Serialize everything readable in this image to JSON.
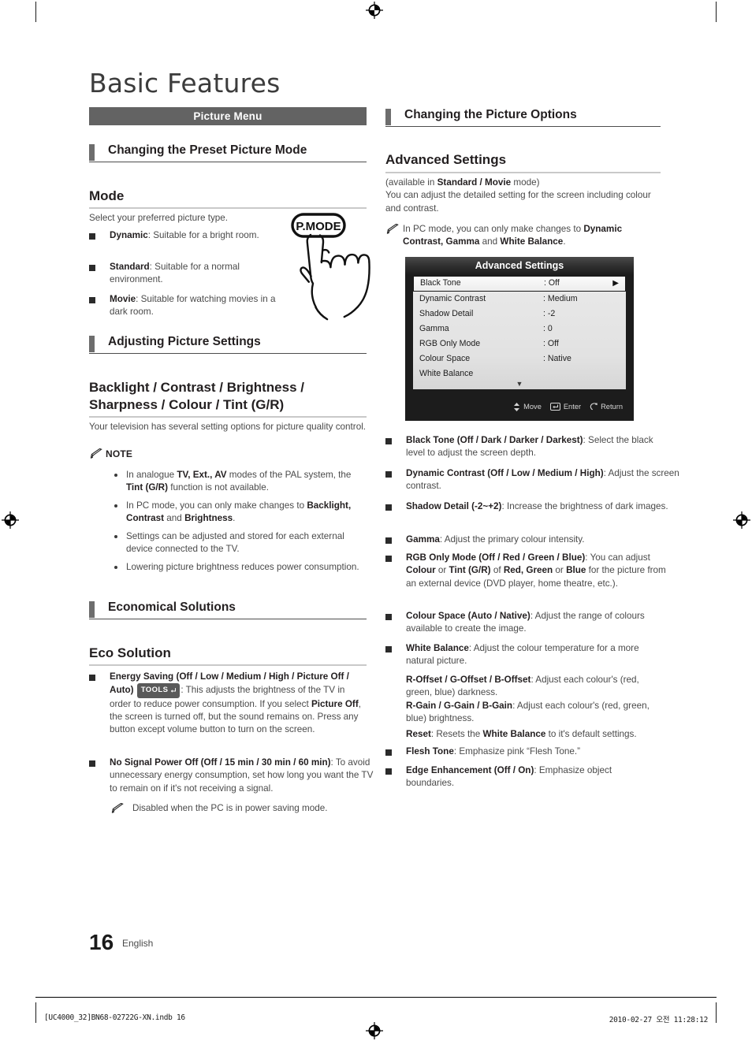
{
  "page": {
    "doc_title": "Basic Features",
    "chapter_bar": "Picture Menu",
    "page_number": "16",
    "language": "English",
    "footer_left": "[UC4000_32]BN68-02722G-XN.indb   16",
    "footer_right": "2010-02-27   오전 11:28:12"
  },
  "left_column": {
    "section1": {
      "title": "Changing the Preset Picture Mode"
    },
    "mode": {
      "heading": "Mode",
      "intro": "Select your preferred picture type.",
      "items": [
        {
          "term": "Dynamic",
          "desc": ": Suitable for a bright room."
        },
        {
          "term": "Standard",
          "desc": ": Suitable for a normal environment."
        },
        {
          "term": "Movie",
          "desc": ": Suitable for watching movies in a dark room."
        }
      ],
      "remote_button_label": "P.MODE"
    },
    "section2": {
      "title": "Adjusting Picture Settings"
    },
    "backlight": {
      "heading_line1": "Backlight / Contrast / Brightness /",
      "heading_line2": "Sharpness / Colour / Tint (G/R)",
      "intro": "Your television has several setting options for picture quality control.",
      "note_label": "NOTE",
      "notes": [
        "In analogue <b>TV, Ext., AV</b> modes of the PAL system, the <b>Tint (G/R)</b> function is not available.",
        "In PC mode, you can only make changes to <b>Backlight, Contrast</b> and <b>Brightness</b>.",
        "Settings can be adjusted and stored for each external device connected to the TV.",
        "Lowering picture brightness reduces power consumption."
      ]
    },
    "section3": {
      "title": "Economical Solutions"
    },
    "eco": {
      "heading": "Eco Solution",
      "items": [
        {
          "html": "<b>Energy Saving (Off / Low / Medium / High / Picture Off / Auto)</b> <span class=\"tools\" data-name=\"tools-badge\">TOOLS<svg class=\"ent\" viewBox=\"0 0 10 10\"><path d=\"M8.3 1.3v4.2H2.6\" fill=\"none\" stroke=\"#fff\" stroke-width=\"1.1\"/><path d=\"M4.2 3.5 2 5.5l2.2 2z\" fill=\"#fff\"/></svg></span>: This adjusts the brightness of the TV in order to reduce power consumption. If you select <b>Picture Off</b>, the screen is turned off, but the sound remains on. Press any button except volume button to turn on the screen."
        },
        {
          "html": "<b>No Signal Power Off (Off / 15 min / 30 min / 60 min)</b>: To avoid unnecessary energy consumption, set how long you want the TV to remain on if it's not receiving a signal."
        }
      ],
      "note": "Disabled when the PC is in power saving mode."
    }
  },
  "right_column": {
    "section1": {
      "title": "Changing the Picture Options"
    },
    "advanced": {
      "heading": "Advanced Settings",
      "intro_html": "(available in <b>Standard / Movie</b> mode)<br>You can adjust the detailed setting for the screen including colour and contrast.",
      "note_html": "In PC mode, you can only make changes to <b>Dynamic Contrast, Gamma</b> and <b>White Balance</b>."
    },
    "osd": {
      "title": "Advanced Settings",
      "rows": [
        {
          "name": "Black Tone",
          "value": ": Off",
          "selected": true,
          "arrow": "▶"
        },
        {
          "name": "Dynamic Contrast",
          "value": ": Medium",
          "selected": false
        },
        {
          "name": "Shadow Detail",
          "value": ": -2",
          "selected": false
        },
        {
          "name": "Gamma",
          "value": ": 0",
          "selected": false
        },
        {
          "name": "RGB Only Mode",
          "value": ": Off",
          "selected": false
        },
        {
          "name": "Colour Space",
          "value": ": Native",
          "selected": false
        },
        {
          "name": "White Balance",
          "value": "",
          "selected": false
        }
      ],
      "scroll_down": "▼",
      "footer": {
        "move": "Move",
        "enter": "Enter",
        "return": "Return"
      }
    },
    "options": [
      {
        "html": "<b>Black Tone (Off / Dark / Darker / Darkest)</b>: Select the black level to adjust the screen depth."
      },
      {
        "html": "<b>Dynamic Contrast (Off / Low / Medium / High)</b>: Adjust the screen contrast."
      },
      {
        "html": "<b>Shadow Detail (-2~+2)</b>: Increase the brightness of dark images."
      },
      {
        "html": "<b>Gamma</b>: Adjust the primary colour intensity."
      },
      {
        "html": "<b>RGB Only Mode (Off / Red / Green / Blue)</b>: You can adjust <b>Colour</b> or <b>Tint (G/R)</b> of <b>Red, Green</b> or <b>Blue</b> for the picture from an external device (DVD player, home theatre, etc.)."
      },
      {
        "html": "<b>Colour Space (Auto / Native)</b>: Adjust the range of colours available to create the image."
      },
      {
        "html": "<b>White Balance</b>: Adjust the colour temperature for a more natural picture."
      },
      {
        "html": "<b>Flesh Tone</b>: Emphasize pink “Flesh Tone.”"
      },
      {
        "html": "<b>Edge Enhancement (Off / On)</b>: Emphasize object boundaries."
      }
    ],
    "white_balance_sub": [
      {
        "html": "<b>R-Offset / G-Offset / B-Offset</b>: Adjust each colour's (red, green, blue) darkness."
      },
      {
        "html": "<b>R-Gain / G-Gain / B-Gain</b>: Adjust each colour's (red, green, blue) brightness."
      },
      {
        "html": "<b>Reset</b>: Resets the <b>White Balance</b> to it's default settings."
      }
    ]
  }
}
